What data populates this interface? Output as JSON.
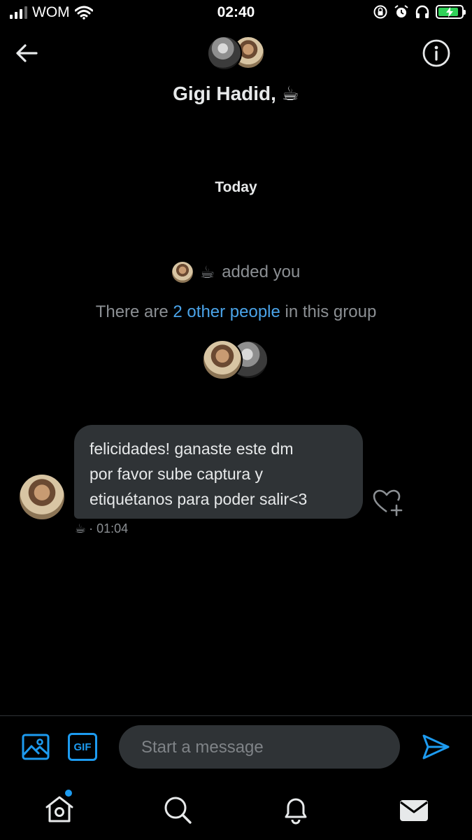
{
  "status_bar": {
    "carrier": "WOM",
    "time": "02:40",
    "battery_color": "#30d158"
  },
  "header": {
    "title": "Gigi Hadid, ☕",
    "back_icon": "arrow-left-icon",
    "info_icon": "info-icon"
  },
  "conversation": {
    "day_label": "Today",
    "added_emoji": "☕",
    "added_text": "added you",
    "group_info": {
      "prefix": "There are ",
      "link": "2 other people",
      "suffix": " in this group"
    }
  },
  "message": {
    "text": "felicidades! ganaste este dm\npor favor sube captura y\netiquétanos para poder salir<3",
    "sender_emoji": "☕",
    "time": "· 01:04"
  },
  "composer": {
    "placeholder": "Start a message",
    "gif_label": "GIF"
  },
  "bottom_nav": {
    "items": [
      "home-icon",
      "search-icon",
      "notifications-icon",
      "messages-icon"
    ]
  },
  "colors": {
    "background": "#000000",
    "bubble": "#2f3336",
    "accent": "#1d9bf0",
    "link": "#4aa3e8",
    "muted": "#8b8f93"
  }
}
